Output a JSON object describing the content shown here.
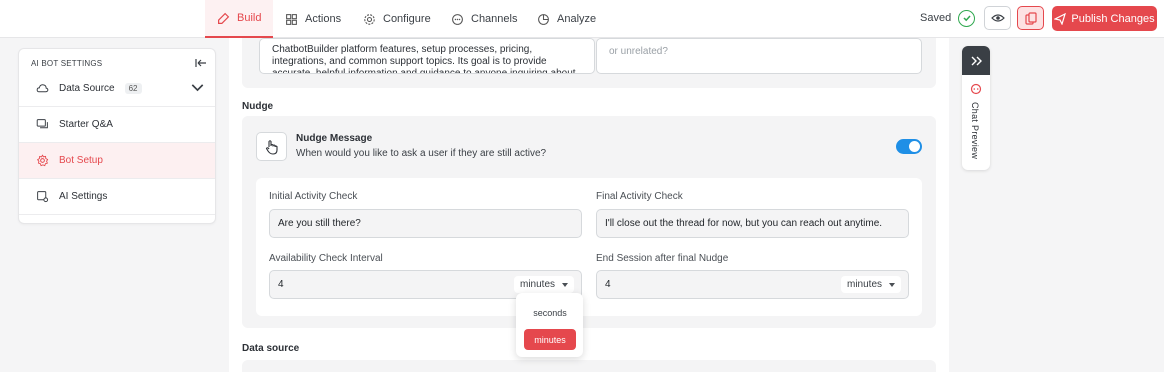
{
  "topnav": {
    "tabs": [
      {
        "label": "Build",
        "icon": "build-icon"
      },
      {
        "label": "Actions",
        "icon": "actions-icon"
      },
      {
        "label": "Configure",
        "icon": "gear-icon"
      },
      {
        "label": "Channels",
        "icon": "channels-icon"
      },
      {
        "label": "Analyze",
        "icon": "analyze-icon"
      }
    ],
    "saved_label": "Saved",
    "publish_label": "Publish Changes"
  },
  "sidebar": {
    "heading": "AI BOT SETTINGS",
    "items": [
      {
        "label": "Data Source",
        "badge": "62"
      },
      {
        "label": "Starter Q&A"
      },
      {
        "label": "Bot Setup"
      },
      {
        "label": "AI Settings"
      }
    ]
  },
  "top_card": {
    "left_text": "ChatbotBuilder platform features, setup processes, pricing, integrations, and common support topics. Its goal is to provide accurate, helpful information and guidance to anyone inquiring about",
    "right_placeholder": "or unrelated?"
  },
  "nudge": {
    "section_title": "Nudge",
    "title": "Nudge Message",
    "subtitle": "When would you like to ask a user if they are still active?",
    "enabled": true,
    "initial_label": "Initial Activity Check",
    "initial_value": "Are you still there?",
    "final_label": "Final Activity Check",
    "final_value": "I'll close out the thread for now, but you can reach out anytime.",
    "interval_label": "Availability Check Interval",
    "interval_value": "4",
    "interval_unit": "minutes",
    "end_label": "End Session after final Nudge",
    "end_value": "4",
    "end_unit": "minutes",
    "unit_options": [
      "seconds",
      "minutes"
    ]
  },
  "data_source_section": {
    "title": "Data source"
  },
  "chat_preview": {
    "label": "Chat Preview"
  },
  "colors": {
    "accent": "#e5484d",
    "toggle": "#1f8fe6",
    "success": "#2fa84f"
  }
}
